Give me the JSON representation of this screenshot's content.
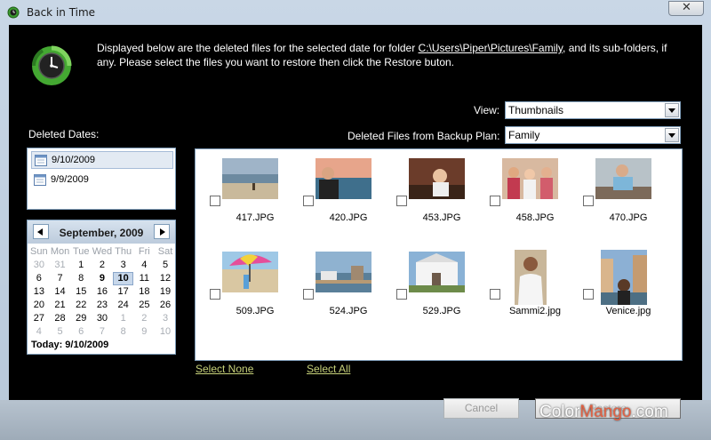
{
  "window": {
    "title": "Back in Time",
    "close_glyph": "✕"
  },
  "instructions": {
    "before": "Displayed below are the deleted files for the selected date for folder ",
    "folder_path": "C:\\Users\\Piper\\Pictures\\Family",
    "after": ", and its sub-folders, if any.  Please select the files you want to restore then click the Restore buton."
  },
  "view": {
    "label": "View:",
    "value": "Thumbnails"
  },
  "backup_plan": {
    "label": "Deleted Files from Backup Plan:",
    "value": "Family"
  },
  "deleted_dates": {
    "label": "Deleted Dates:",
    "items": [
      {
        "label": "9/10/2009",
        "selected": true
      },
      {
        "label": "9/9/2009",
        "selected": false
      }
    ]
  },
  "calendar": {
    "month_label": "September, 2009",
    "weekdays": [
      "Sun",
      "Mon",
      "Tue",
      "Wed",
      "Thu",
      "Fri",
      "Sat"
    ],
    "weeks": [
      [
        "30",
        "31",
        "1",
        "2",
        "3",
        "4",
        "5"
      ],
      [
        "6",
        "7",
        "8",
        "9",
        "10",
        "11",
        "12"
      ],
      [
        "13",
        "14",
        "15",
        "16",
        "17",
        "18",
        "19"
      ],
      [
        "20",
        "21",
        "22",
        "23",
        "24",
        "25",
        "26"
      ],
      [
        "27",
        "28",
        "29",
        "30",
        "1",
        "2",
        "3"
      ],
      [
        "4",
        "5",
        "6",
        "7",
        "8",
        "9",
        "10"
      ]
    ],
    "today_label": "Today: 9/10/2009"
  },
  "files": [
    {
      "name": "417.JPG",
      "icon": "beach-dog-photo-icon"
    },
    {
      "name": "420.JPG",
      "icon": "man-at-sea-photo-icon"
    },
    {
      "name": "453.JPG",
      "icon": "baby-photo-icon"
    },
    {
      "name": "458.JPG",
      "icon": "three-women-photo-icon"
    },
    {
      "name": "470.JPG",
      "icon": "man-at-table-photo-icon"
    },
    {
      "name": "509.JPG",
      "icon": "beach-umbrella-photo-icon"
    },
    {
      "name": "524.JPG",
      "icon": "harbor-photo-icon"
    },
    {
      "name": "529.JPG",
      "icon": "white-house-photo-icon"
    },
    {
      "name": "Sammi2.jpg",
      "icon": "bride-photo-icon"
    },
    {
      "name": "Venice.jpg",
      "icon": "venice-photo-icon"
    }
  ],
  "links": {
    "select_none": "Select None",
    "select_all": "Select All"
  },
  "buttons": {
    "cancel": "Cancel",
    "restore": "Restore"
  },
  "watermark": {
    "part1": "Color",
    "part2": "Mango",
    "part3": ".com"
  }
}
